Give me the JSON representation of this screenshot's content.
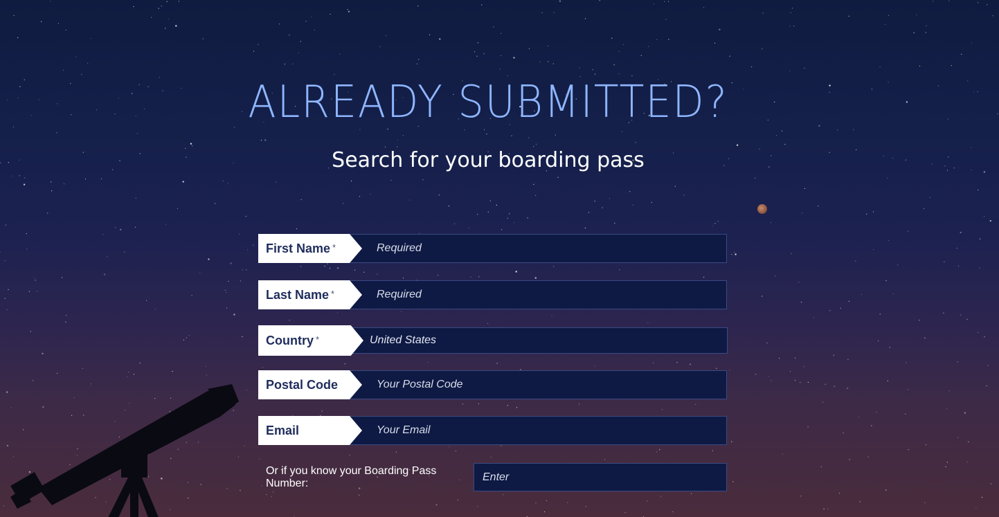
{
  "heading": {
    "title": "ALREADY SUBMITTED?",
    "subtitle": "Search for your boarding pass"
  },
  "form": {
    "fields": [
      {
        "label": "First Name",
        "required_marker": "*",
        "placeholder": "Required"
      },
      {
        "label": "Last Name",
        "required_marker": "*",
        "placeholder": "Required"
      },
      {
        "label": "Country",
        "required_marker": "*",
        "value": "United States"
      },
      {
        "label": "Postal Code",
        "placeholder": "Your Postal Code"
      },
      {
        "label": "Email",
        "placeholder": "Your Email"
      }
    ],
    "boarding_pass": {
      "label": "Or if you know your Boarding Pass Number:",
      "placeholder": "Enter"
    }
  },
  "colors": {
    "title": "#8fb6ff",
    "label_text": "#1f2d5c",
    "input_bg": "#0e1a44",
    "input_border": "#3a4a82"
  },
  "decor": {
    "telescope_icon": "telescope-silhouette-icon",
    "planet_icon": "planet-icon"
  }
}
